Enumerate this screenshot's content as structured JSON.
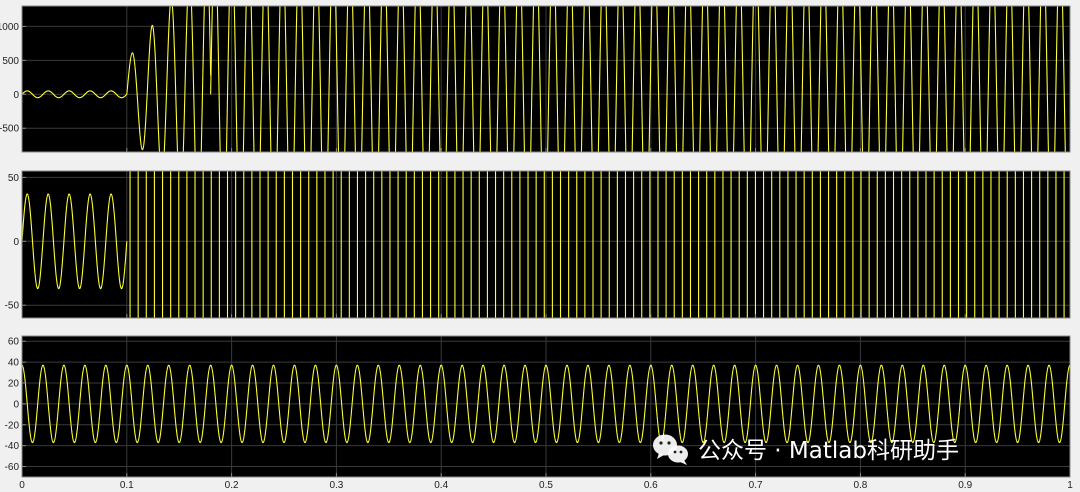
{
  "figure": {
    "background_color": "#f0f0f0",
    "plot_background_color": "#000000",
    "grid_color": "#3a3a3a",
    "axes_border_color": "#8a8a8a",
    "trace_color": "#ffff33"
  },
  "chart_data": [
    {
      "type": "line",
      "xlim": [
        0,
        1
      ],
      "ylim": [
        -850,
        1300
      ],
      "grid": true,
      "x_ticks": [
        0,
        0.1,
        0.2,
        0.3,
        0.4,
        0.5,
        0.6,
        0.7,
        0.8,
        0.9,
        1
      ],
      "y_ticks": [
        -500,
        0,
        500,
        1000
      ],
      "y_tick_labels": [
        "-500",
        "0",
        "500",
        "1000"
      ],
      "series": [
        {
          "segments": [
            {
              "kind": "sine",
              "t_start": 0,
              "t_end": 0.1,
              "frequency_hz": 50,
              "amplitude": 50,
              "offset": 0
            },
            {
              "kind": "chirp",
              "t_start": 0.1,
              "t_end": 0.18,
              "frequency_start_hz": 50,
              "frequency_end_hz": 62,
              "amplitude_start": 500,
              "amplitude_end": 2200,
              "offset": 0
            },
            {
              "kind": "sine",
              "t_start": 0.18,
              "t_end": 1,
              "frequency_hz": 62,
              "amplitude": 2200,
              "offset": 0
            }
          ]
        }
      ]
    },
    {
      "type": "line",
      "xlim": [
        0,
        1
      ],
      "ylim": [
        -60,
        55
      ],
      "grid": true,
      "x_ticks": [
        0,
        0.1,
        0.2,
        0.3,
        0.4,
        0.5,
        0.6,
        0.7,
        0.8,
        0.9,
        1
      ],
      "y_ticks": [
        -50,
        0,
        50
      ],
      "y_tick_labels": [
        "-50",
        "0",
        "50"
      ],
      "series": [
        {
          "segments": [
            {
              "kind": "sine",
              "t_start": 0,
              "t_end": 0.1,
              "frequency_hz": 50,
              "amplitude": 37,
              "offset": 0
            },
            {
              "kind": "spikes",
              "t_start": 0.1,
              "t_end": 1,
              "interval_s": 0.00775,
              "low": -60,
              "high": 55
            }
          ]
        }
      ]
    },
    {
      "type": "line",
      "xlim": [
        0,
        1
      ],
      "ylim": [
        -70,
        65
      ],
      "grid": true,
      "x_ticks": [
        0,
        0.1,
        0.2,
        0.3,
        0.4,
        0.5,
        0.6,
        0.7,
        0.8,
        0.9,
        1
      ],
      "x_tick_labels": [
        "0",
        "0.1",
        "0.2",
        "0.3",
        "0.4",
        "0.5",
        "0.6",
        "0.7",
        "0.8",
        "0.9",
        "1"
      ],
      "y_ticks": [
        -60,
        -40,
        -20,
        0,
        20,
        40,
        60
      ],
      "y_tick_labels": [
        "-60",
        "-40",
        "-20",
        "0",
        "20",
        "40",
        "60"
      ],
      "series": [
        {
          "segments": [
            {
              "kind": "sine",
              "t_start": 0,
              "t_end": 1,
              "frequency_hz": 50,
              "amplitude": 37,
              "offset": 0,
              "phase_deg": 90
            }
          ]
        }
      ]
    }
  ],
  "watermark": {
    "text": "公众号 · Matlab科研助手",
    "icon": "wechat-icon",
    "color": "#ffffff"
  }
}
